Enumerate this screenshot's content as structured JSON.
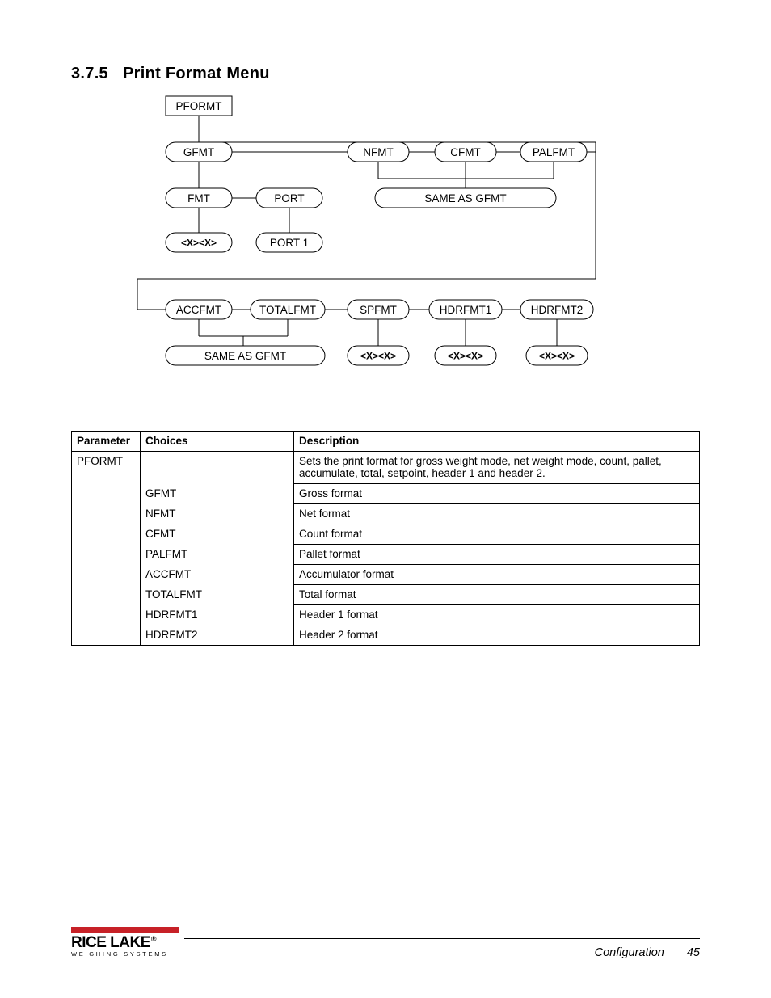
{
  "section": {
    "number": "3.7.5",
    "title": "Print Format Menu"
  },
  "diagram": {
    "root": "PFORMT",
    "row1": [
      "GFMT",
      "NFMT",
      "CFMT",
      "PALFMT"
    ],
    "gfmt_children": [
      "FMT",
      "PORT"
    ],
    "fmt_leaf": "<X><X>",
    "port_leaf": "PORT 1",
    "same_as_gfmt": "SAME AS GFMT",
    "row2": [
      "ACCFMT",
      "TOTALFMT",
      "SPFMT",
      "HDRFMT1",
      "HDRFMT2"
    ],
    "row2_leaves": [
      "SAME AS GFMT",
      "<X><X>",
      "<X><X>",
      "<X><X>"
    ]
  },
  "table": {
    "headers": [
      "Parameter",
      "Choices",
      "Description"
    ],
    "rows": [
      {
        "parameter": "PFORMT",
        "choices": "",
        "description": "Sets the print format for gross weight mode, net weight mode, count, pallet, accumulate, total, setpoint, header 1 and header 2."
      },
      {
        "parameter": "",
        "choices": "GFMT",
        "description": "Gross format"
      },
      {
        "parameter": "",
        "choices": "NFMT",
        "description": "Net format"
      },
      {
        "parameter": "",
        "choices": "CFMT",
        "description": "Count format"
      },
      {
        "parameter": "",
        "choices": "PALFMT",
        "description": "Pallet format"
      },
      {
        "parameter": "",
        "choices": "ACCFMT",
        "description": "Accumulator format"
      },
      {
        "parameter": "",
        "choices": "TOTALFMT",
        "description": "Total format"
      },
      {
        "parameter": "",
        "choices": "HDRFMT1",
        "description": "Header 1 format"
      },
      {
        "parameter": "",
        "choices": "HDRFMT2",
        "description": "Header 2 format"
      }
    ]
  },
  "footer": {
    "brand": "RICE LAKE",
    "tagline": "WEIGHING SYSTEMS",
    "section": "Configuration",
    "page": "45"
  }
}
